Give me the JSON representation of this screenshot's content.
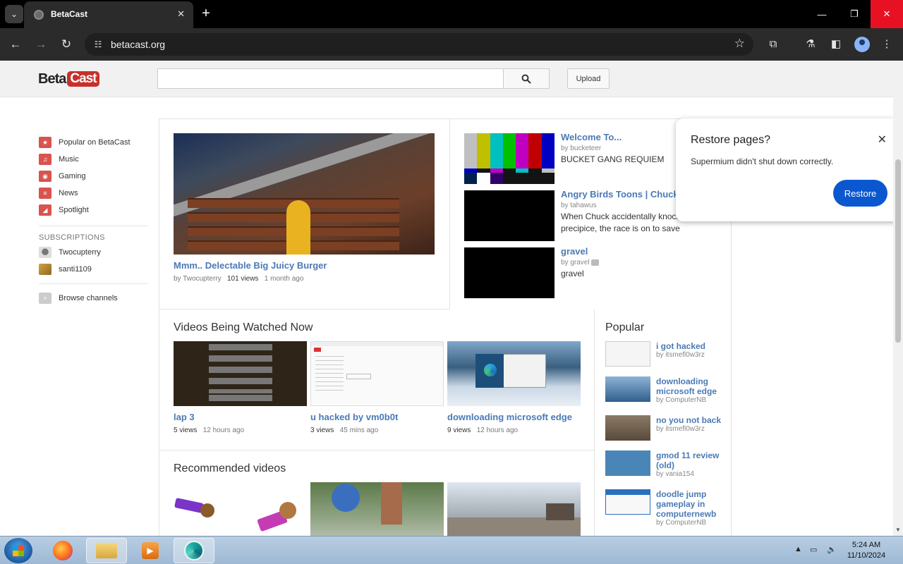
{
  "browser": {
    "tab_title": "BetaCast",
    "url": "betacast.org",
    "tab_close": "✕",
    "new_tab": "+",
    "window_buttons": {
      "minimize": "—",
      "maximize": "❐",
      "close": "✕"
    }
  },
  "site": {
    "logo_left": "Beta",
    "logo_right": "Cast",
    "search_placeholder": "",
    "upload_label": "Upload"
  },
  "sidebar": {
    "items": [
      {
        "label": "Popular on BetaCast",
        "icon": "popular-icon",
        "color": "#d9534f"
      },
      {
        "label": "Music",
        "icon": "headphones-icon",
        "color": "#d9534f"
      },
      {
        "label": "Gaming",
        "icon": "gamepad-icon",
        "color": "#d9534f"
      },
      {
        "label": "News",
        "icon": "newspaper-icon",
        "color": "#d9534f"
      },
      {
        "label": "Spotlight",
        "icon": "spotlight-icon",
        "color": "#d9534f"
      }
    ],
    "subscriptions_heading": "SUBSCRIPTIONS",
    "subscriptions": [
      {
        "label": "Twocupterry"
      },
      {
        "label": "santi1109"
      }
    ],
    "browse_label": "Browse channels"
  },
  "featured": {
    "title": "Mmm.. Delectable Big Juicy Burger",
    "by": "by Twocupterry",
    "views": "101 views",
    "age": "1 month ago"
  },
  "side_videos": [
    {
      "title": "Welcome To...",
      "by": "by bucketeer",
      "desc": "BUCKET GANG REQUIEM"
    },
    {
      "title": "Angry Birds Toons | Chuck Time -...",
      "by": "by tahawus",
      "desc": "When Chuck accidentally knocks Red off a precipice, the race is on to save"
    },
    {
      "title": "gravel",
      "by": "by gravel",
      "desc": "gravel"
    }
  ],
  "watching": {
    "heading": "Videos Being Watched Now",
    "videos": [
      {
        "title": "lap 3",
        "views": "5 views",
        "age": "12 hours ago"
      },
      {
        "title": "u hacked by vm0b0t",
        "views": "3 views",
        "age": "45 mins ago"
      },
      {
        "title": "downloading microsoft edge",
        "views": "9 views",
        "age": "12 hours ago"
      }
    ]
  },
  "popular": {
    "heading": "Popular",
    "videos": [
      {
        "title": "i got hacked",
        "by": "by itsmefl0w3rz"
      },
      {
        "title": "downloading microsoft edge",
        "by": "by ComputerNB"
      },
      {
        "title": "no you not back",
        "by": "by itsmefl0w3rz"
      },
      {
        "title": "gmod 11 review (old)",
        "by": "by vania154"
      },
      {
        "title": "doodle jump gameplay in computernewb",
        "by": "by ComputerNB"
      }
    ]
  },
  "recommended": {
    "heading": "Recommended videos"
  },
  "restore_dialog": {
    "title": "Restore pages?",
    "message": "Supermium didn't shut down correctly.",
    "button": "Restore",
    "close": "✕"
  },
  "taskbar": {
    "time": "5:24 AM",
    "date": "11/10/2024"
  }
}
